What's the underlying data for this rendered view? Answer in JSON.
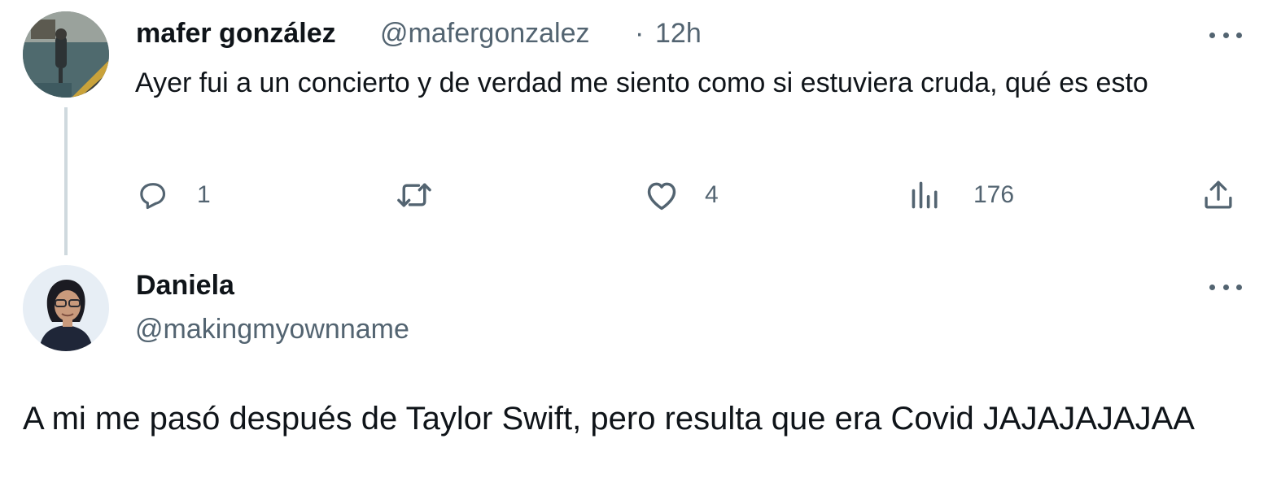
{
  "original_tweet": {
    "author_name": "mafer gonzález",
    "handle": "@mafergonzalez",
    "separator": "·",
    "time": "12h",
    "text": "Ayer fui a un concierto y de verdad me siento como si estuviera cruda, qué es esto",
    "actions": {
      "reply_count": "1",
      "retweet_count": "",
      "like_count": "4",
      "view_count": "176"
    },
    "icons": [
      "reply-icon",
      "retweet-icon",
      "like-icon",
      "views-icon",
      "share-icon",
      "more-icon"
    ]
  },
  "reply_tweet": {
    "author_name": "Daniela",
    "handle": "@makingmyownname",
    "text": "A mi me pasó después de Taylor Swift, pero resulta que era Covid JAJAJAJAJAA"
  },
  "colors": {
    "text_primary": "#0f1419",
    "text_secondary": "#536471",
    "thread_line": "#cfd9de",
    "background": "#ffffff"
  }
}
